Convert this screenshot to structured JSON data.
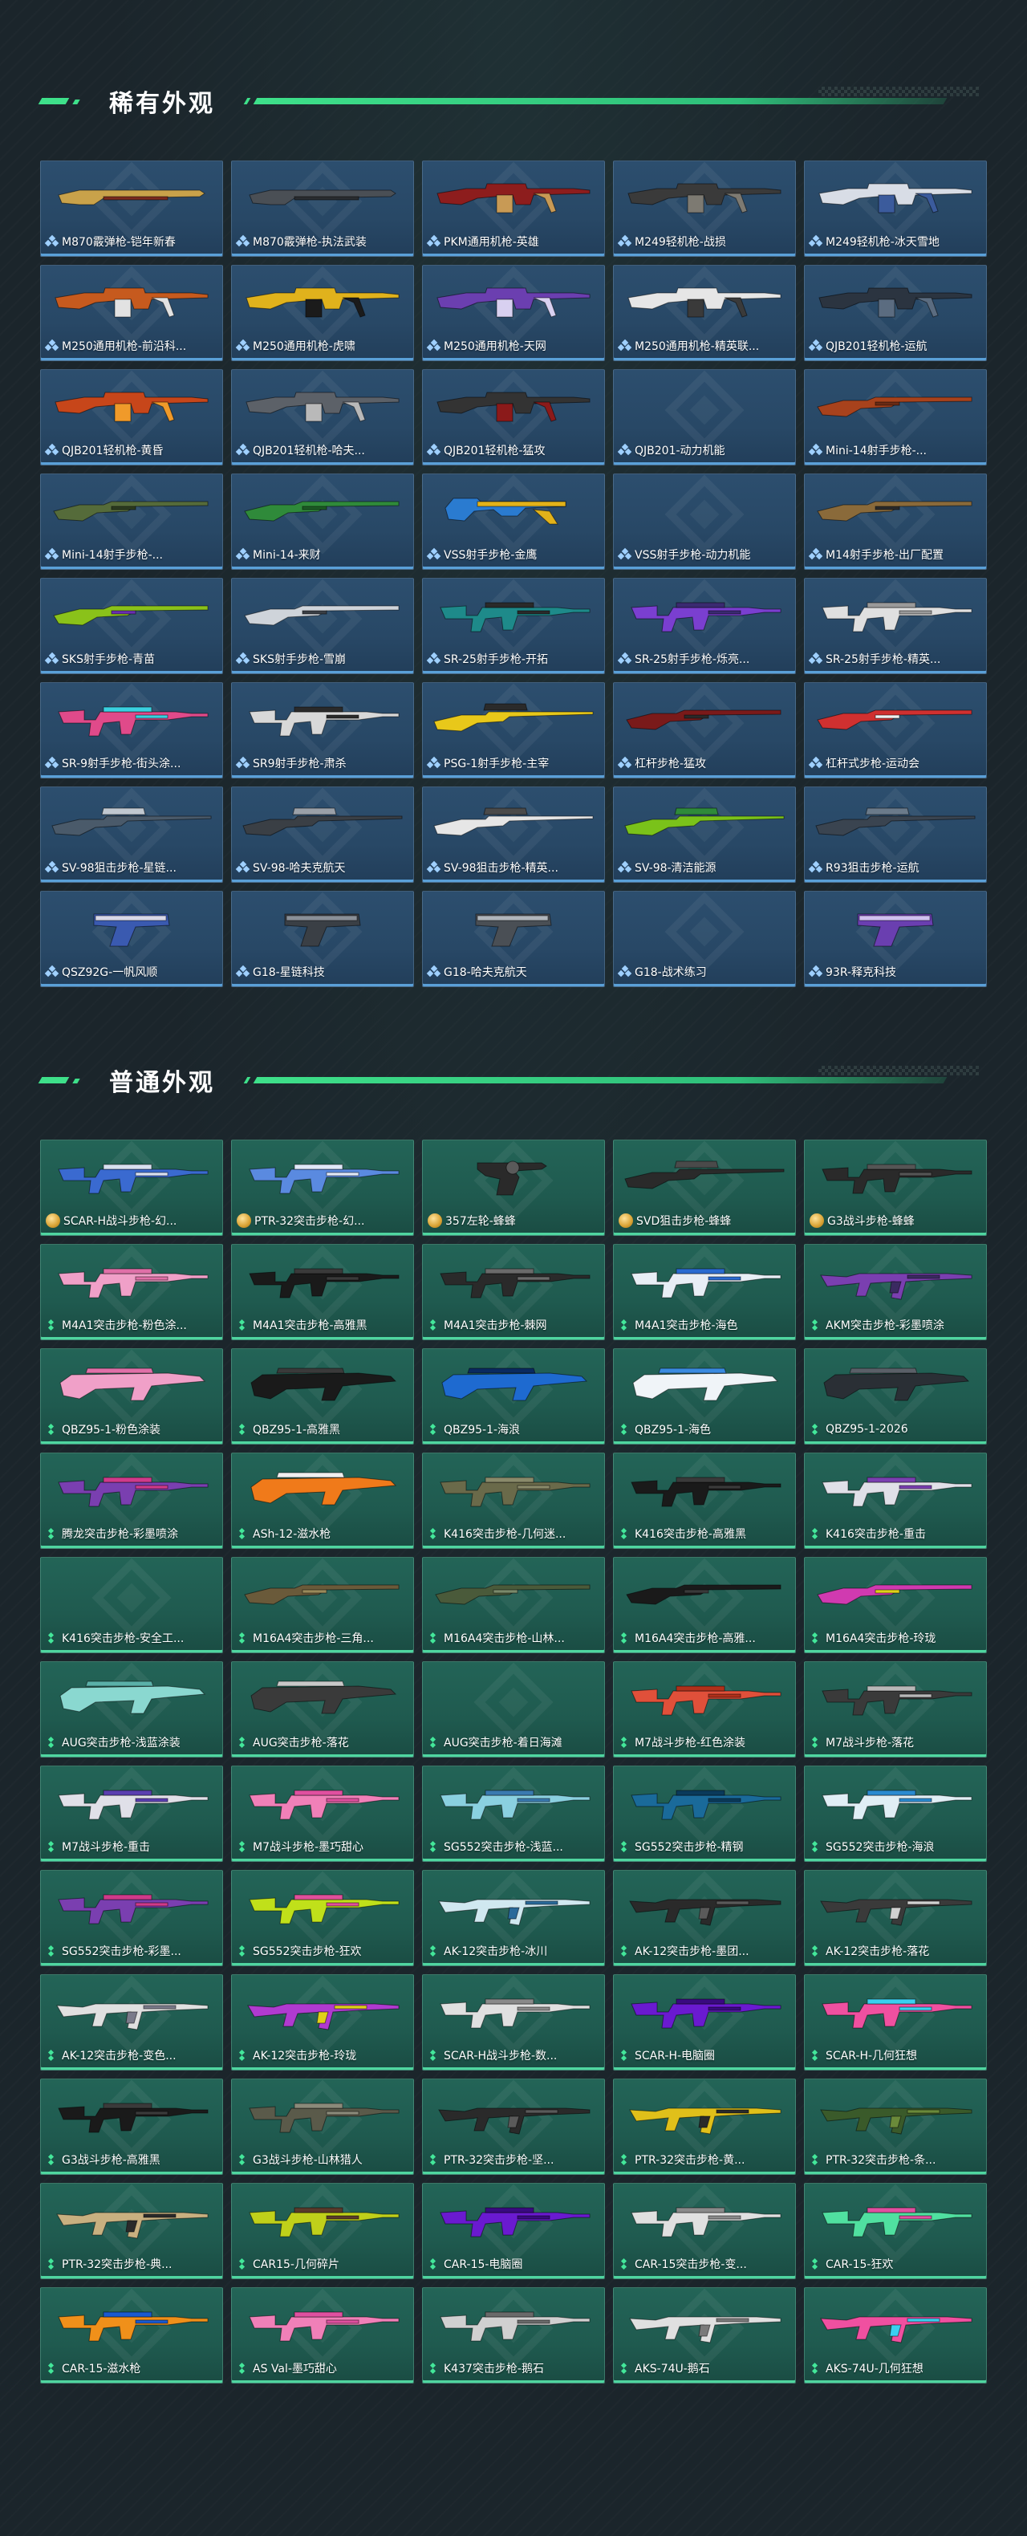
{
  "rare_section": {
    "title": "稀有外观",
    "items": [
      {
        "label": "M870霰弹枪-铠年新春",
        "gun": "shotgun",
        "colors": [
          "#c9a24a",
          "#7b2a1e"
        ]
      },
      {
        "label": "M870霰弹枪-执法武装",
        "gun": "shotgun",
        "colors": [
          "#4a4f55",
          "#2a2d31"
        ]
      },
      {
        "label": "PKM通用机枪-英雄",
        "gun": "lmg",
        "colors": [
          "#8d1d1d",
          "#c89a55"
        ]
      },
      {
        "label": "M249轻机枪-战损",
        "gun": "lmg",
        "colors": [
          "#3a3a3a",
          "#7d7a72"
        ]
      },
      {
        "label": "M249轻机枪-冰天雪地",
        "gun": "lmg",
        "colors": [
          "#d8dde6",
          "#3b5b9c"
        ]
      },
      {
        "label": "M250通用机枪-前沿科...",
        "gun": "lmg",
        "colors": [
          "#c65a1e",
          "#e2e2e2"
        ]
      },
      {
        "label": "M250通用机枪-虎啸",
        "gun": "lmg",
        "colors": [
          "#e0b21c",
          "#1b1b1b"
        ]
      },
      {
        "label": "M250通用机枪-天网",
        "gun": "lmg",
        "colors": [
          "#6b3fb0",
          "#d8d0f0"
        ]
      },
      {
        "label": "M250通用机枪-精英联...",
        "gun": "lmg",
        "colors": [
          "#e6e6e6",
          "#3a3a3a"
        ]
      },
      {
        "label": "QJB201轻机枪-运航",
        "gun": "lmg",
        "colors": [
          "#2b3440",
          "#5b6c80"
        ]
      },
      {
        "label": "QJB201轻机枪-黄昏",
        "gun": "lmg",
        "colors": [
          "#c7461a",
          "#f09a2a"
        ]
      },
      {
        "label": "QJB201轻机枪-哈夫...",
        "gun": "lmg",
        "colors": [
          "#5c6168",
          "#b9b9b9"
        ]
      },
      {
        "label": "QJB201轻机枪-猛攻",
        "gun": "lmg",
        "colors": [
          "#333333",
          "#8b1a1a"
        ]
      },
      {
        "label": "QJB201-动力机能",
        "gun": "none",
        "colors": [
          "#000000",
          "#000000"
        ]
      },
      {
        "label": "Mini-14射手步枪-...",
        "gun": "rifle",
        "colors": [
          "#a8421c",
          "#6a2a14"
        ]
      },
      {
        "label": "Mini-14射手步枪-...",
        "gun": "rifle",
        "colors": [
          "#556b3a",
          "#2c3b20"
        ]
      },
      {
        "label": "Mini-14-来财",
        "gun": "rifle",
        "colors": [
          "#2f8a3a",
          "#1c5a24"
        ]
      },
      {
        "label": "VSS射手步枪-金鹰",
        "gun": "smg",
        "colors": [
          "#e2b21a",
          "#2a7bd0"
        ]
      },
      {
        "label": "VSS射手步枪-动力机能",
        "gun": "none",
        "colors": [
          "#000000",
          "#000000"
        ]
      },
      {
        "label": "M14射手步枪-出厂配置",
        "gun": "rifle",
        "colors": [
          "#8a6a3a",
          "#2a2a2a"
        ]
      },
      {
        "label": "SKS射手步枪-青苗",
        "gun": "rifle",
        "colors": [
          "#8ac21a",
          "#6a2fb0"
        ]
      },
      {
        "label": "SKS射手步枪-雪崩",
        "gun": "rifle",
        "colors": [
          "#cfd4da",
          "#3a3f45"
        ]
      },
      {
        "label": "SR-25射手步枪-开拓",
        "gun": "ar",
        "colors": [
          "#1e8a8a",
          "#2a2a2a"
        ]
      },
      {
        "label": "SR-25射手步枪-烁亮...",
        "gun": "ar",
        "colors": [
          "#7a3fd0",
          "#3a2a70"
        ]
      },
      {
        "label": "SR-25射手步枪-精英...",
        "gun": "ar",
        "colors": [
          "#e0e0e0",
          "#9a9a9a"
        ]
      },
      {
        "label": "SR-9射手步枪-街头涂...",
        "gun": "ar",
        "colors": [
          "#e04a8a",
          "#3ad0e0"
        ]
      },
      {
        "label": "SR9射手步枪-肃杀",
        "gun": "ar",
        "colors": [
          "#d8d8d8",
          "#2a2a2a"
        ]
      },
      {
        "label": "PSG-1射手步枪-主宰",
        "gun": "sniper",
        "colors": [
          "#e8c81a",
          "#2a2a2a"
        ]
      },
      {
        "label": "杠杆步枪-猛攻",
        "gun": "rifle",
        "colors": [
          "#7a1a1a",
          "#2a2a2a"
        ]
      },
      {
        "label": "杠杆式步枪-运动会",
        "gun": "rifle",
        "colors": [
          "#d03030",
          "#f0f0f0"
        ]
      },
      {
        "label": "SV-98狙击步枪-星链...",
        "gun": "sniper",
        "colors": [
          "#4a5a6a",
          "#c0c8d0"
        ]
      },
      {
        "label": "SV-98-哈夫克航天",
        "gun": "sniper",
        "colors": [
          "#3a3f45",
          "#9aa0a8"
        ]
      },
      {
        "label": "SV-98狙击步枪-精英...",
        "gun": "sniper",
        "colors": [
          "#e6e6e6",
          "#4a4a4a"
        ]
      },
      {
        "label": "SV-98-清洁能源",
        "gun": "sniper",
        "colors": [
          "#7ac21a",
          "#2f8a3a"
        ]
      },
      {
        "label": "R93狙击步枪-运航",
        "gun": "sniper",
        "colors": [
          "#3a4450",
          "#6a7a8a"
        ]
      },
      {
        "label": "QSZ92G-一帆风顺",
        "gun": "pistol",
        "colors": [
          "#3a5ab0",
          "#d8d8e8"
        ]
      },
      {
        "label": "G18-星链科技",
        "gun": "pistol",
        "colors": [
          "#3a3f45",
          "#8a9098"
        ]
      },
      {
        "label": "G18-哈夫克航天",
        "gun": "pistol",
        "colors": [
          "#4a4f55",
          "#b0b5bb"
        ]
      },
      {
        "label": "G18-战术练习",
        "gun": "none",
        "colors": [
          "#000000",
          "#000000"
        ]
      },
      {
        "label": "93R-释克科技",
        "gun": "pistol",
        "colors": [
          "#6a3fb0",
          "#d0c0f0"
        ]
      }
    ]
  },
  "common_section": {
    "title": "普通外观",
    "items": [
      {
        "label": "SCAR-H战斗步枪-幻...",
        "tier": "gold",
        "gun": "ar",
        "colors": [
          "#3a6ad0",
          "#d8e0f0"
        ]
      },
      {
        "label": "PTR-32突击步枪-幻...",
        "tier": "gold",
        "gun": "ar",
        "colors": [
          "#5a8ae0",
          "#e0e8f8"
        ]
      },
      {
        "label": "357左轮-蜂蜂",
        "tier": "gold",
        "gun": "revolver",
        "colors": [
          "#2a2a2a",
          "#5a5a5a"
        ]
      },
      {
        "label": "SVD狙击步枪-蜂蜂",
        "tier": "gold",
        "gun": "sniper",
        "colors": [
          "#2a2a2a",
          "#4a4a4a"
        ]
      },
      {
        "label": "G3战斗步枪-蜂蜂",
        "tier": "gold",
        "gun": "ar",
        "colors": [
          "#2a2a2a",
          "#555555"
        ]
      },
      {
        "label": "M4A1突击步枪-粉色涂...",
        "tier": "green",
        "gun": "ar",
        "colors": [
          "#f0a0c8",
          "#e070a8"
        ]
      },
      {
        "label": "M4A1突击步枪-高雅黑",
        "tier": "green",
        "gun": "ar",
        "colors": [
          "#1a1a1a",
          "#3a3a3a"
        ]
      },
      {
        "label": "M4A1突击步枪-棘网",
        "tier": "green",
        "gun": "ar",
        "colors": [
          "#2a2a2a",
          "#6a6a6a"
        ]
      },
      {
        "label": "M4A1突击步枪-海色",
        "tier": "green",
        "gun": "ar",
        "colors": [
          "#e8eef5",
          "#2a6ad0"
        ]
      },
      {
        "label": "AKM突击步枪-彩墨喷涂",
        "tier": "green",
        "gun": "ak",
        "colors": [
          "#7a3fb0",
          "#3a2a60"
        ]
      },
      {
        "label": "QBZ95-1-粉色涂装",
        "tier": "green",
        "gun": "bullpup",
        "colors": [
          "#f0a0c8",
          "#e070a8"
        ]
      },
      {
        "label": "QBZ95-1-高雅黑",
        "tier": "green",
        "gun": "bullpup",
        "colors": [
          "#1a1a1a",
          "#3a3a3a"
        ]
      },
      {
        "label": "QBZ95-1-海浪",
        "tier": "green",
        "gun": "bullpup",
        "colors": [
          "#1e6ad0",
          "#0a2a60"
        ]
      },
      {
        "label": "QBZ95-1-海色",
        "tier": "green",
        "gun": "bullpup",
        "colors": [
          "#f0f4f8",
          "#3a8ae0"
        ]
      },
      {
        "label": "QBZ95-1-2026",
        "tier": "green",
        "gun": "bullpup",
        "colors": [
          "#2a2f35",
          "#5a6068"
        ]
      },
      {
        "label": "腾龙突击步枪-彩墨喷涂",
        "tier": "green",
        "gun": "ar",
        "colors": [
          "#7a3fb0",
          "#d03a8a"
        ]
      },
      {
        "label": "ASh-12-滋水枪",
        "tier": "green",
        "gun": "bullpup",
        "colors": [
          "#f07a1a",
          "#f0f0f0"
        ]
      },
      {
        "label": "K416突击步枪-几何迷...",
        "tier": "green",
        "gun": "ar",
        "colors": [
          "#6a6a4a",
          "#8a8a6a"
        ]
      },
      {
        "label": "K416突击步枪-高雅黑",
        "tier": "green",
        "gun": "ar",
        "colors": [
          "#1a1a1a",
          "#3a3a3a"
        ]
      },
      {
        "label": "K416突击步枪-重击",
        "tier": "green",
        "gun": "ar",
        "colors": [
          "#e0e0e8",
          "#7a3fb0"
        ]
      },
      {
        "label": "K416突击步枪-安全工...",
        "tier": "green",
        "gun": "none",
        "colors": [
          "#000000",
          "#000000"
        ]
      },
      {
        "label": "M16A4突击步枪-三角...",
        "tier": "green",
        "gun": "rifle",
        "colors": [
          "#6a5a3a",
          "#9a8a5a"
        ]
      },
      {
        "label": "M16A4突击步枪-山林...",
        "tier": "green",
        "gun": "rifle",
        "colors": [
          "#4a5a3a",
          "#7a8a6a"
        ]
      },
      {
        "label": "M16A4突击步枪-高雅...",
        "tier": "green",
        "gun": "rifle",
        "colors": [
          "#1a1a1a",
          "#3a3a3a"
        ]
      },
      {
        "label": "M16A4突击步枪-玲珑",
        "tier": "green",
        "gun": "rifle",
        "colors": [
          "#d03ab0",
          "#e0d01a"
        ]
      },
      {
        "label": "AUG突击步枪-浅蓝涂装",
        "tier": "green",
        "gun": "bullpup",
        "colors": [
          "#8ad8d0",
          "#5ab0a8"
        ]
      },
      {
        "label": "AUG突击步枪-落花",
        "tier": "green",
        "gun": "bullpup",
        "colors": [
          "#3a3a3a",
          "#c8c8c8"
        ]
      },
      {
        "label": "AUG突击步枪-着日海滩",
        "tier": "green",
        "gun": "none",
        "colors": [
          "#000000",
          "#000000"
        ]
      },
      {
        "label": "M7战斗步枪-红色涂装",
        "tier": "green",
        "gun": "ar",
        "colors": [
          "#e0503a",
          "#b0301a"
        ]
      },
      {
        "label": "M7战斗步枪-落花",
        "tier": "green",
        "gun": "ar",
        "colors": [
          "#3a3a3a",
          "#b8b8b8"
        ]
      },
      {
        "label": "M7战斗步枪-重击",
        "tier": "green",
        "gun": "ar",
        "colors": [
          "#e0e0e8",
          "#5a3fb0"
        ]
      },
      {
        "label": "M7战斗步枪-墨巧甜心",
        "tier": "green",
        "gun": "ar",
        "colors": [
          "#f080b8",
          "#e050a0"
        ]
      },
      {
        "label": "SG552突击步枪-浅蓝...",
        "tier": "green",
        "gun": "ar",
        "colors": [
          "#8ad0e0",
          "#3a7ab0"
        ]
      },
      {
        "label": "SG552突击步枪-精钢",
        "tier": "green",
        "gun": "ar",
        "colors": [
          "#1a6a9a",
          "#0a3a5a"
        ]
      },
      {
        "label": "SG552突击步枪-海浪",
        "tier": "green",
        "gun": "ar",
        "colors": [
          "#e0eef5",
          "#2a8ad0"
        ]
      },
      {
        "label": "SG552突击步枪-彩墨...",
        "tier": "green",
        "gun": "ar",
        "colors": [
          "#7a3fb0",
          "#d03a8a"
        ]
      },
      {
        "label": "SG552突击步枪-狂欢",
        "tier": "green",
        "gun": "ar",
        "colors": [
          "#c0e01a",
          "#e0509a"
        ]
      },
      {
        "label": "AK-12突击步枪-冰川",
        "tier": "green",
        "gun": "ak",
        "colors": [
          "#d0e8f0",
          "#2a6a9a"
        ]
      },
      {
        "label": "AK-12突击步枪-墨团...",
        "tier": "green",
        "gun": "ak",
        "colors": [
          "#2a2a2a",
          "#5a5a5a"
        ]
      },
      {
        "label": "AK-12突击步枪-落花",
        "tier": "green",
        "gun": "ak",
        "colors": [
          "#3a3a3a",
          "#d0d0d0"
        ]
      },
      {
        "label": "AK-12突击步枪-变色...",
        "tier": "green",
        "gun": "ak",
        "colors": [
          "#e0e0e0",
          "#7a7a8a"
        ]
      },
      {
        "label": "AK-12突击步枪-玲珑",
        "tier": "green",
        "gun": "ak",
        "colors": [
          "#b03ad0",
          "#e0d01a"
        ]
      },
      {
        "label": "SCAR-H战斗步枪-数...",
        "tier": "green",
        "gun": "ar",
        "colors": [
          "#e0e0e0",
          "#8a8a8a"
        ]
      },
      {
        "label": "SCAR-H-电脑圈",
        "tier": "green",
        "gun": "ar",
        "colors": [
          "#6a1ad0",
          "#3a0a80"
        ]
      },
      {
        "label": "SCAR-H-几何狂想",
        "tier": "green",
        "gun": "ar",
        "colors": [
          "#f050a0",
          "#3ad0f0"
        ]
      },
      {
        "label": "G3战斗步枪-高雅黑",
        "tier": "green",
        "gun": "ar",
        "colors": [
          "#1a1a1a",
          "#3a3a3a"
        ]
      },
      {
        "label": "G3战斗步枪-山林猎人",
        "tier": "green",
        "gun": "ar",
        "colors": [
          "#5a5a4a",
          "#8a8a7a"
        ]
      },
      {
        "label": "PTR-32突击步枪-坚...",
        "tier": "green",
        "gun": "ak",
        "colors": [
          "#2a2a2a",
          "#5a5a5a"
        ]
      },
      {
        "label": "PTR-32突击步枪-黄...",
        "tier": "green",
        "gun": "ak",
        "colors": [
          "#e0c01a",
          "#2a2a2a"
        ]
      },
      {
        "label": "PTR-32突击步枪-条...",
        "tier": "green",
        "gun": "ak",
        "colors": [
          "#3a5a2a",
          "#6a8a3a"
        ]
      },
      {
        "label": "PTR-32突击步枪-典...",
        "tier": "green",
        "gun": "ak",
        "colors": [
          "#c8b080",
          "#2a2a2a"
        ]
      },
      {
        "label": "CAR15-几何碎片",
        "tier": "green",
        "gun": "ar",
        "colors": [
          "#c0d01a",
          "#5a3a2a"
        ]
      },
      {
        "label": "CAR-15-电脑圈",
        "tier": "green",
        "gun": "ar",
        "colors": [
          "#6a1ad0",
          "#3a0a80"
        ]
      },
      {
        "label": "CAR-15突击步枪-变...",
        "tier": "green",
        "gun": "ar",
        "colors": [
          "#e0e0e0",
          "#8a8a8a"
        ]
      },
      {
        "label": "CAR-15-狂欢",
        "tier": "green",
        "gun": "ar",
        "colors": [
          "#50e0a0",
          "#e050a0"
        ]
      },
      {
        "label": "CAR-15-滋水枪",
        "tier": "green",
        "gun": "ar",
        "colors": [
          "#f0901a",
          "#1a5ad0"
        ]
      },
      {
        "label": "AS Val-墨巧甜心",
        "tier": "green",
        "gun": "ar",
        "colors": [
          "#f080b8",
          "#e050a0"
        ]
      },
      {
        "label": "K437突击步枪-鹅石",
        "tier": "green",
        "gun": "ar",
        "colors": [
          "#d0d0d0",
          "#6a6a6a"
        ]
      },
      {
        "label": "AKS-74U-鹅石",
        "tier": "green",
        "gun": "ak",
        "colors": [
          "#e0e0e0",
          "#7a7a7a"
        ]
      },
      {
        "label": "AKS-74U-几何狂想",
        "tier": "green",
        "gun": "ak",
        "colors": [
          "#f050a0",
          "#3ad0f0"
        ]
      }
    ]
  }
}
